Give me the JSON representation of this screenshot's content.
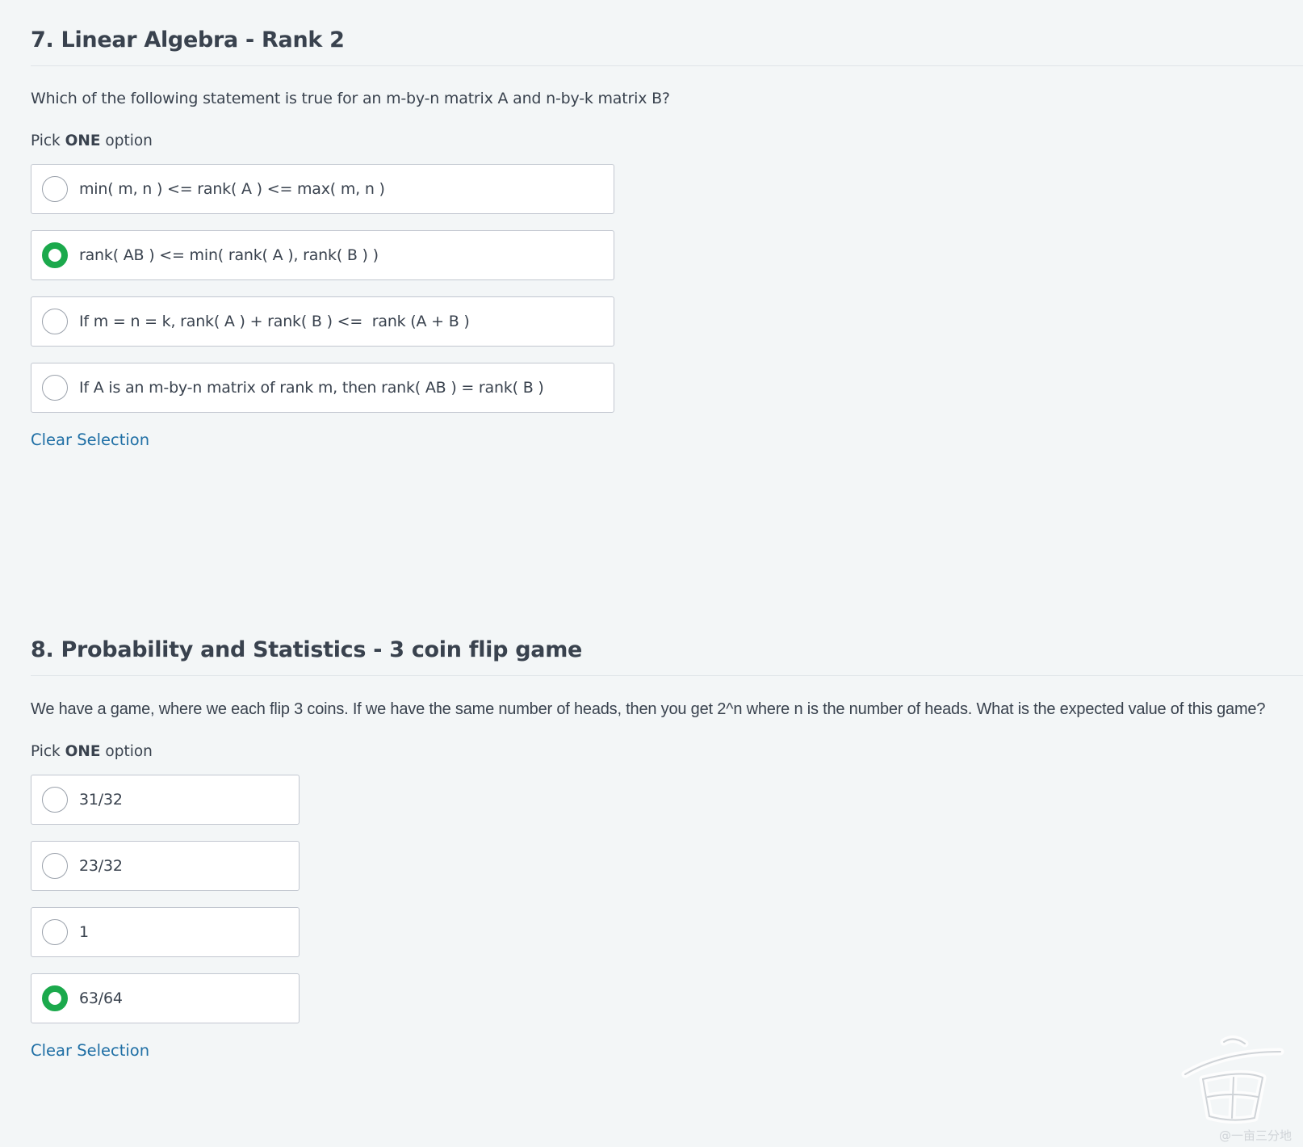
{
  "questions": [
    {
      "title": "7. Linear Algebra - Rank 2",
      "text": "Which of the following statement is true for an m-by-n matrix A and n-by-k matrix B?",
      "pick_prefix": "Pick ",
      "pick_bold": "ONE",
      "pick_suffix": " option",
      "options": [
        {
          "label": "min( m, n ) <= rank( A ) <= max( m, n )",
          "selected": false
        },
        {
          "label": "rank( AB ) <= min( rank( A ), rank( B ) )",
          "selected": true
        },
        {
          "label": "If m = n = k, rank( A ) + rank( B ) <=  rank (A + B )",
          "selected": false
        },
        {
          "label": "If A is an m-by-n matrix of rank m, then rank( AB ) = rank( B )",
          "selected": false
        }
      ],
      "clear_label": "Clear Selection"
    },
    {
      "title": "8. Probability and Statistics - 3 coin flip game",
      "text": "We have a game, where we each flip 3 coins. If we have the same number of heads, then you get 2^n where n is the number of heads. What is the expected value of this game?",
      "pick_prefix": "Pick ",
      "pick_bold": "ONE",
      "pick_suffix": " option",
      "options": [
        {
          "label": "31/32",
          "selected": false
        },
        {
          "label": "23/32",
          "selected": false
        },
        {
          "label": "1",
          "selected": false
        },
        {
          "label": "63/64",
          "selected": true
        }
      ],
      "clear_label": "Clear Selection"
    }
  ],
  "colors": {
    "selected_radio": "#1ba94c",
    "link": "#1f6fa5",
    "text": "#39424e",
    "background": "#f3f6f7"
  },
  "watermark": {
    "text": "@一亩三分地"
  }
}
